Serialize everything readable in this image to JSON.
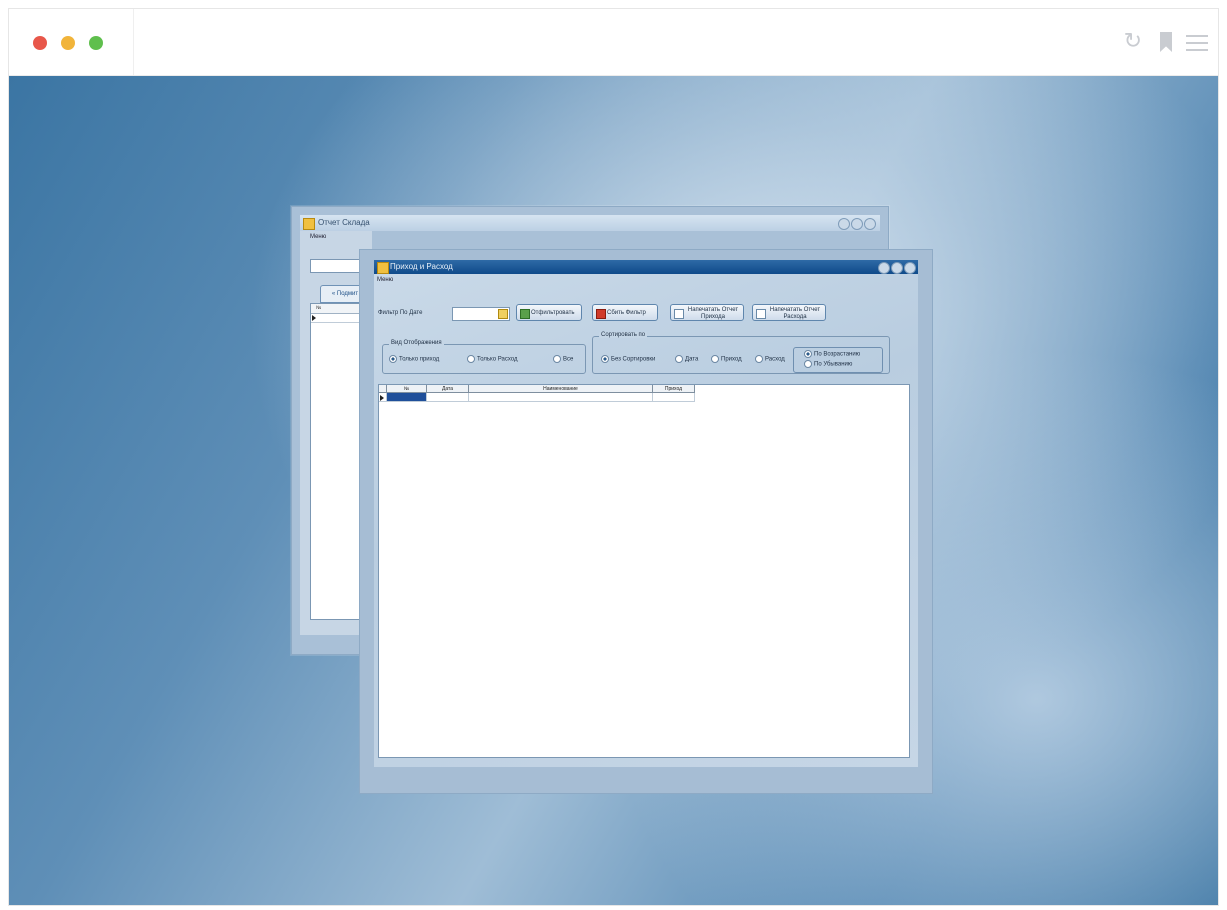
{
  "browser": {
    "controls": [
      "close",
      "minimize",
      "maximize"
    ],
    "icons": [
      "reload-icon",
      "bookmark-icon",
      "menu-icon"
    ]
  },
  "back_window": {
    "title": "Отчет Склада",
    "menu": "Меню",
    "tab_label": "« Подмит",
    "grid_header_no": "№"
  },
  "front_window": {
    "title": "Приход и Расход",
    "menu": "Меню",
    "filter_label": "Фильтр По Дате",
    "buttons": {
      "apply": "Отфильтровать",
      "reset": "Сбить Фильтр",
      "print_income": "Напечатать Отчет Прихода",
      "print_expense": "Напечатать Отчет Расхода"
    },
    "view_group": {
      "title": "Вид Отображения",
      "options": [
        "Только приход",
        "Только Расход",
        "Все"
      ],
      "selected": "Только приход"
    },
    "sort_group": {
      "title": "Сортировать по",
      "options": [
        "Без Сортировки",
        "Дата",
        "Приход",
        "Расход"
      ],
      "selected": "Без Сортировки"
    },
    "order_group": {
      "options": [
        "По Возрастанию",
        "По Убыванию"
      ],
      "selected": "По Возрастанию"
    },
    "grid": {
      "columns": [
        "№",
        "Дата",
        "Наименование",
        "Приход"
      ]
    }
  }
}
